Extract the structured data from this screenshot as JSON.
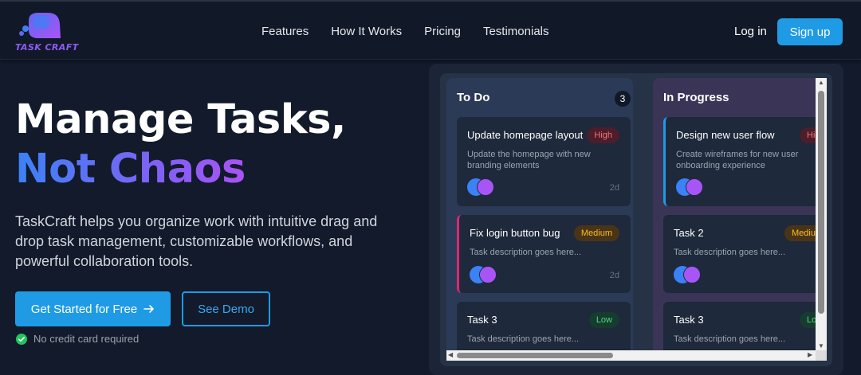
{
  "header": {
    "logo_text": "TASK CRAFT",
    "nav": [
      "Features",
      "How It Works",
      "Pricing",
      "Testimonials"
    ],
    "login_label": "Log in",
    "signup_label": "Sign up"
  },
  "hero": {
    "title_line1": "Manage Tasks,",
    "title_line2": "Not Chaos",
    "description": "TaskCraft helps you organize work with intuitive drag and drop task management, customizable workflows, and powerful collaboration tools.",
    "cta_primary": "Get Started for Free",
    "cta_secondary": "See Demo",
    "note": "No credit card required"
  },
  "board": {
    "columns": [
      {
        "title": "To Do",
        "count": "3",
        "cards": [
          {
            "title": "Update homepage layout",
            "priority": "High",
            "description": "Update the homepage with new branding elements",
            "age": "2d"
          },
          {
            "title": "Fix login button bug",
            "priority": "Medium",
            "description": "Task description goes here...",
            "age": "2d"
          },
          {
            "title": "Task 3",
            "priority": "Low",
            "description": "Task description goes here..."
          }
        ]
      },
      {
        "title": "In Progress",
        "cards": [
          {
            "title": "Design new user flow",
            "priority": "High",
            "description": "Create wireframes for new user onboarding experience"
          },
          {
            "title": "Task 2",
            "priority": "Medium",
            "description": "Task description goes here..."
          },
          {
            "title": "Task 3",
            "priority": "Low",
            "description": "Task description goes here..."
          }
        ]
      }
    ]
  },
  "colors": {
    "accent": "#1e9be4",
    "background": "#121a2b",
    "gradient": [
      "#3b82f6",
      "#8b5cf6",
      "#d946ef"
    ]
  }
}
